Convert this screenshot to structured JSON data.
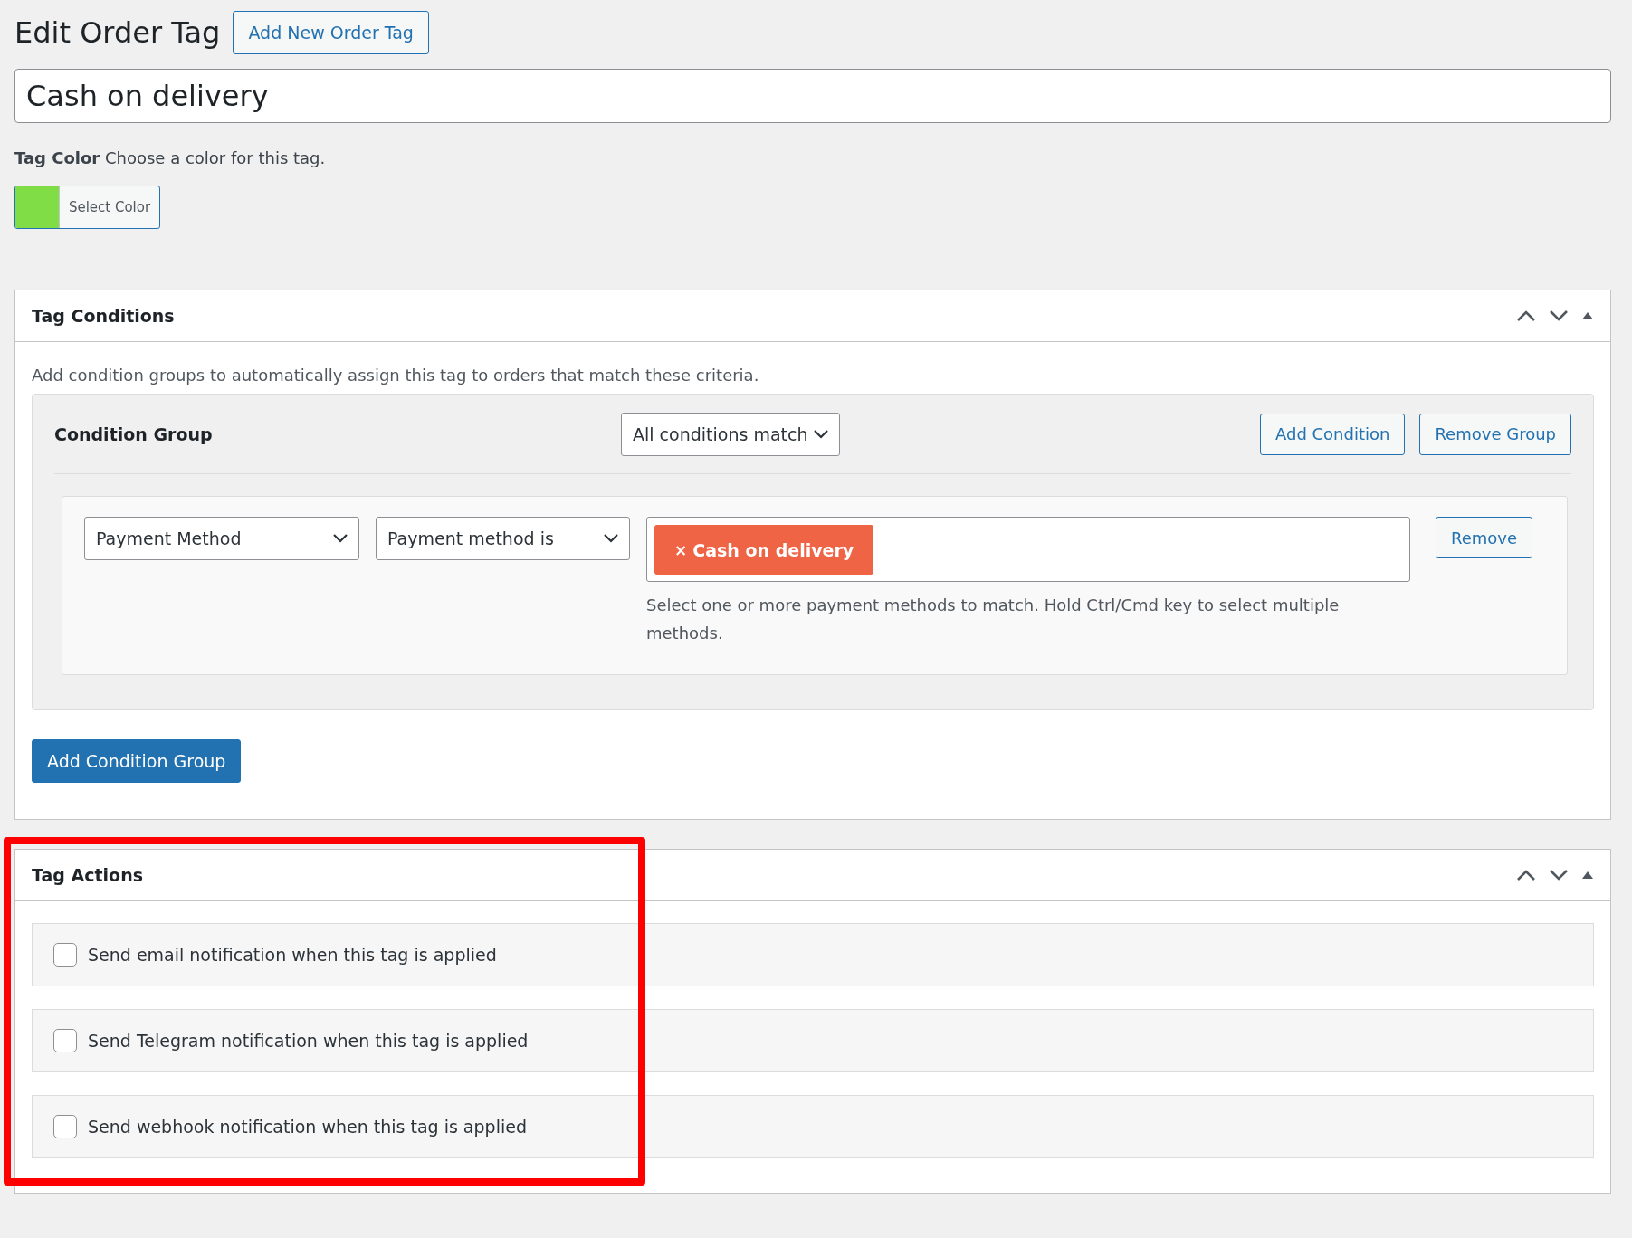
{
  "page_title": "Edit Order Tag",
  "add_new_button": "Add New Order Tag",
  "tag_name": {
    "value": "Cash on delivery"
  },
  "tag_color": {
    "label": "Tag Color",
    "hint": "Choose a color for this tag.",
    "button": "Select Color",
    "color": "#80dd45"
  },
  "tag_conditions": {
    "title": "Tag Conditions",
    "description": "Add condition groups to automatically assign this tag to orders that match these criteria.",
    "groups": [
      {
        "title": "Condition Group",
        "match": "All conditions match",
        "add_condition": "Add Condition",
        "remove_group": "Remove Group",
        "conditions": [
          {
            "field": "Payment Method",
            "operator": "Payment method is",
            "values": [
              "Cash on delivery"
            ],
            "remove_symbol": "×",
            "help": "Select one or more payment methods to match. Hold Ctrl/Cmd key to select multiple methods.",
            "remove": "Remove"
          }
        ]
      }
    ],
    "add_group_button": "Add Condition Group"
  },
  "tag_actions": {
    "title": "Tag Actions",
    "highlighted": true,
    "items": [
      {
        "label": "Send email notification when this tag is applied",
        "checked": false
      },
      {
        "label": "Send Telegram notification when this tag is applied",
        "checked": false
      },
      {
        "label": "Send webhook notification when this tag is applied",
        "checked": false
      }
    ]
  }
}
